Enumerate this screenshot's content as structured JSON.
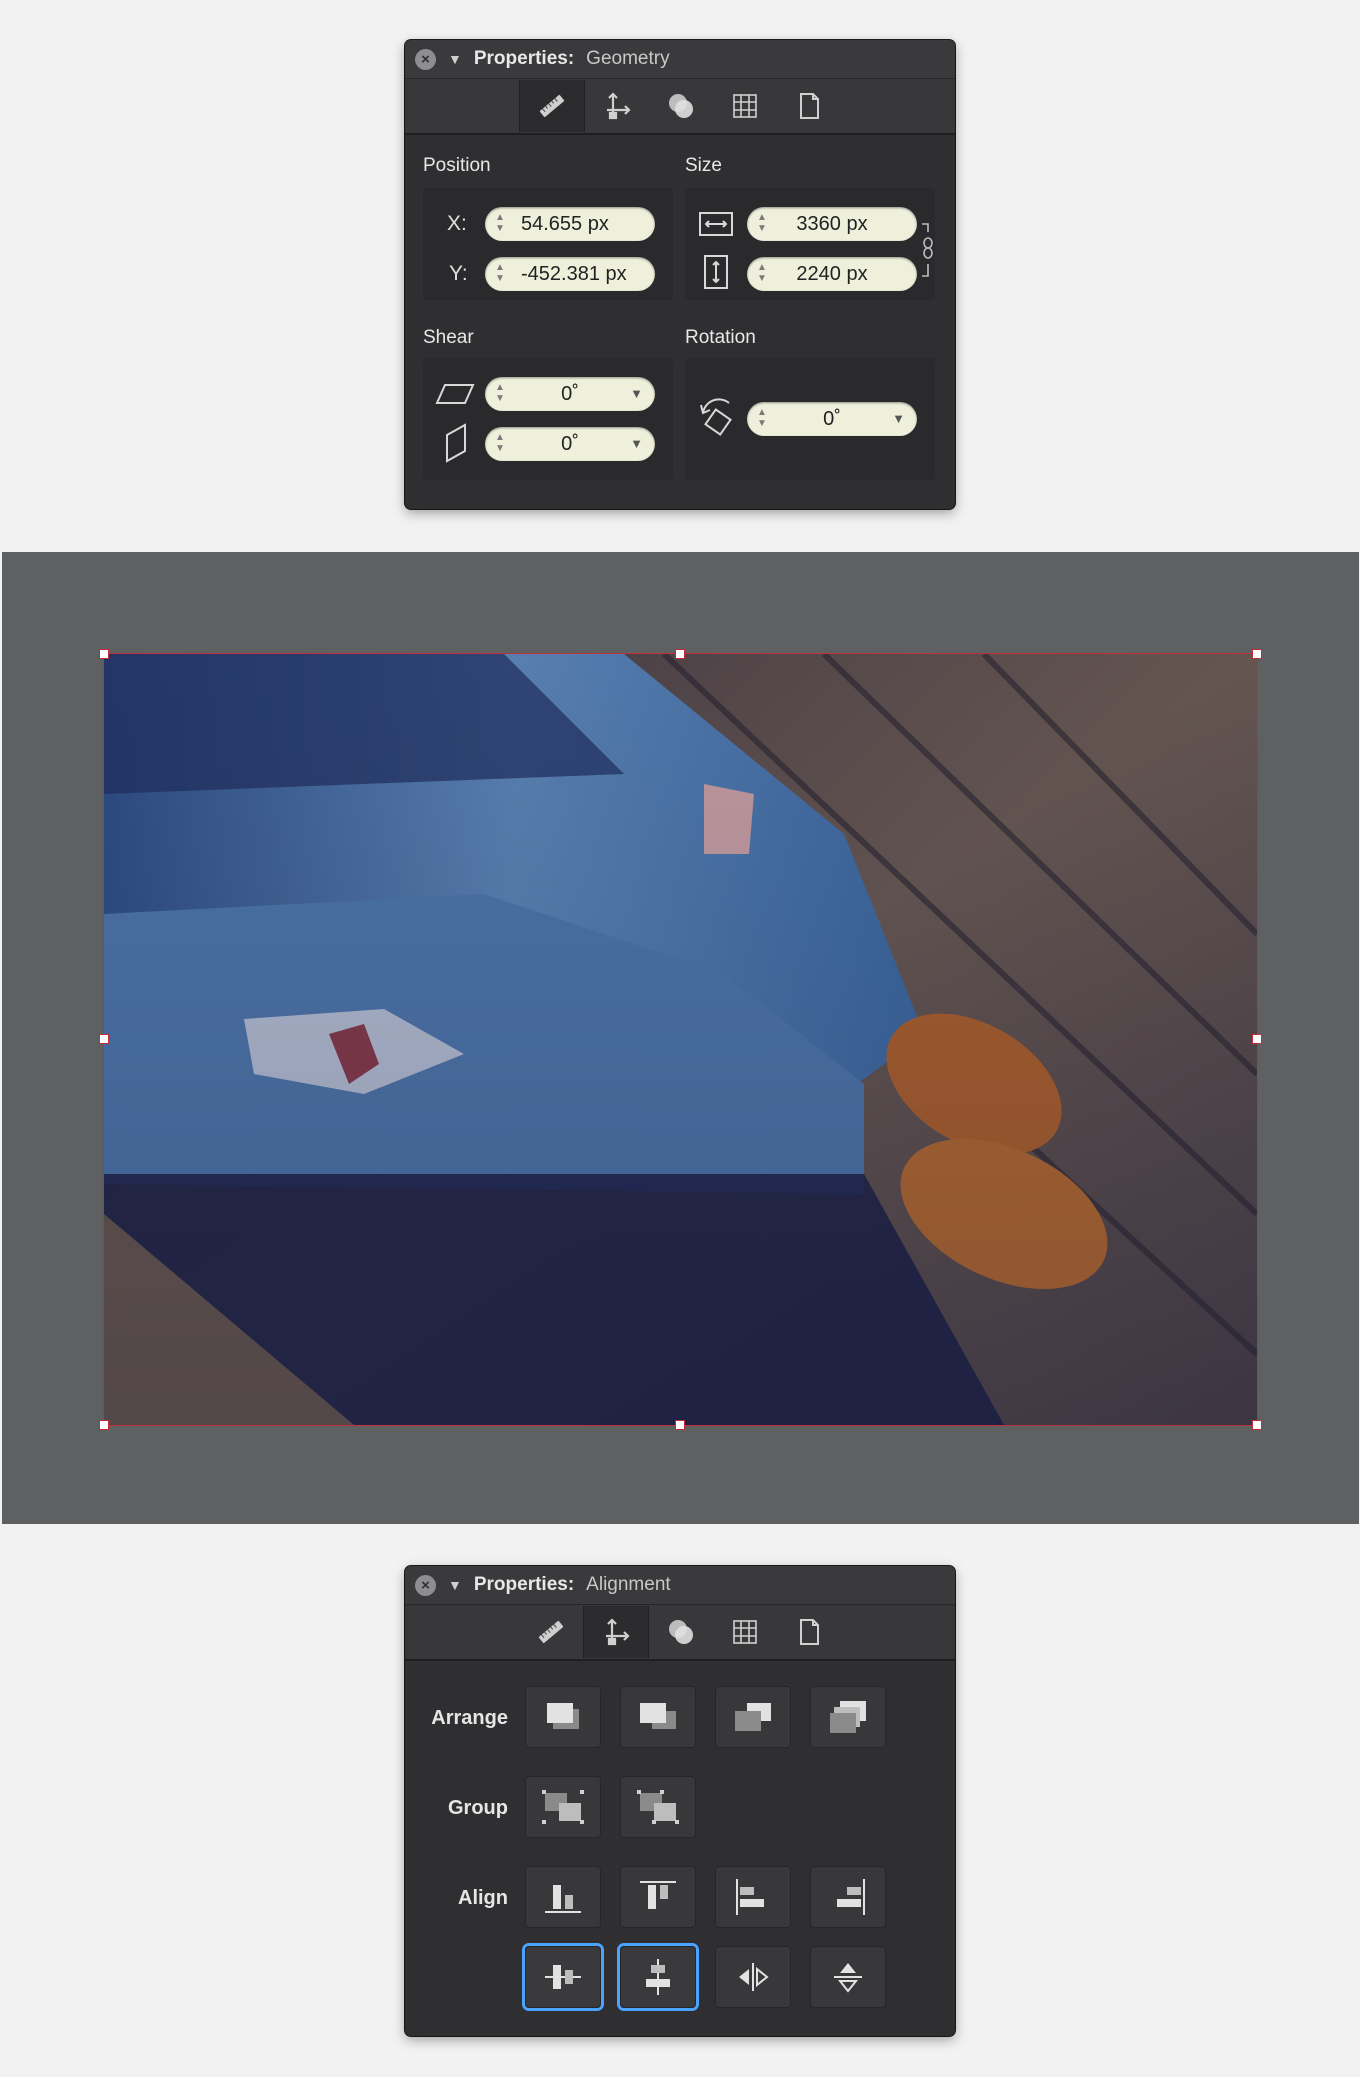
{
  "geometry_panel": {
    "title": "Properties:",
    "subtitle": "Geometry",
    "toolbar_icons": [
      "ruler-icon",
      "transform-icon",
      "circles-icon",
      "grid-icon",
      "page-icon"
    ],
    "position_label": "Position",
    "size_label": "Size",
    "x_label": "X:",
    "y_label": "Y:",
    "x_value": "54.655 px",
    "y_value": "-452.381 px",
    "width_value": "3360 px",
    "height_value": "2240 px",
    "shear_label": "Shear",
    "rotation_label": "Rotation",
    "shear_h_value": "0˚",
    "shear_v_value": "0˚",
    "rotation_value": "0˚"
  },
  "canvas": {
    "photo": "jeans-and-shoes-photo"
  },
  "alignment_panel": {
    "title": "Properties:",
    "subtitle": "Alignment",
    "arrange_label": "Arrange",
    "group_label": "Group",
    "align_label": "Align"
  },
  "colors": {
    "panel_bg": "#2f2f31",
    "field_bg": "#eef0dc",
    "canvas_bg": "#5f6062",
    "selection": "#c0303b",
    "focus": "#4aa3ff"
  }
}
